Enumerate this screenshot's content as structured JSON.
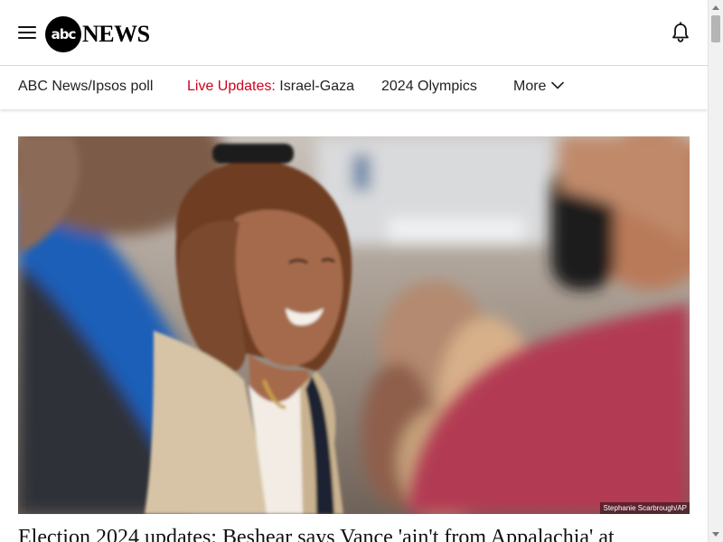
{
  "header": {
    "menu_icon": "hamburger-menu-icon",
    "logo": {
      "circle_text": "abc",
      "word": "NEWS"
    },
    "notifications_icon": "bell-icon"
  },
  "nav": {
    "items": [
      {
        "label": "ABC News/Ipsos poll"
      },
      {
        "prefix": "Live Updates:",
        "label": "Israel-Gaza"
      },
      {
        "label": "2024 Olympics"
      },
      {
        "label": "More",
        "icon": "chevron-down-icon"
      }
    ],
    "live_color": "#d0021b"
  },
  "hero": {
    "credit": "Stephanie Scarbrough/AP"
  },
  "headline": {
    "text": "Election 2024 updates: Beshear says Vance 'ain't from Appalachia' at"
  }
}
